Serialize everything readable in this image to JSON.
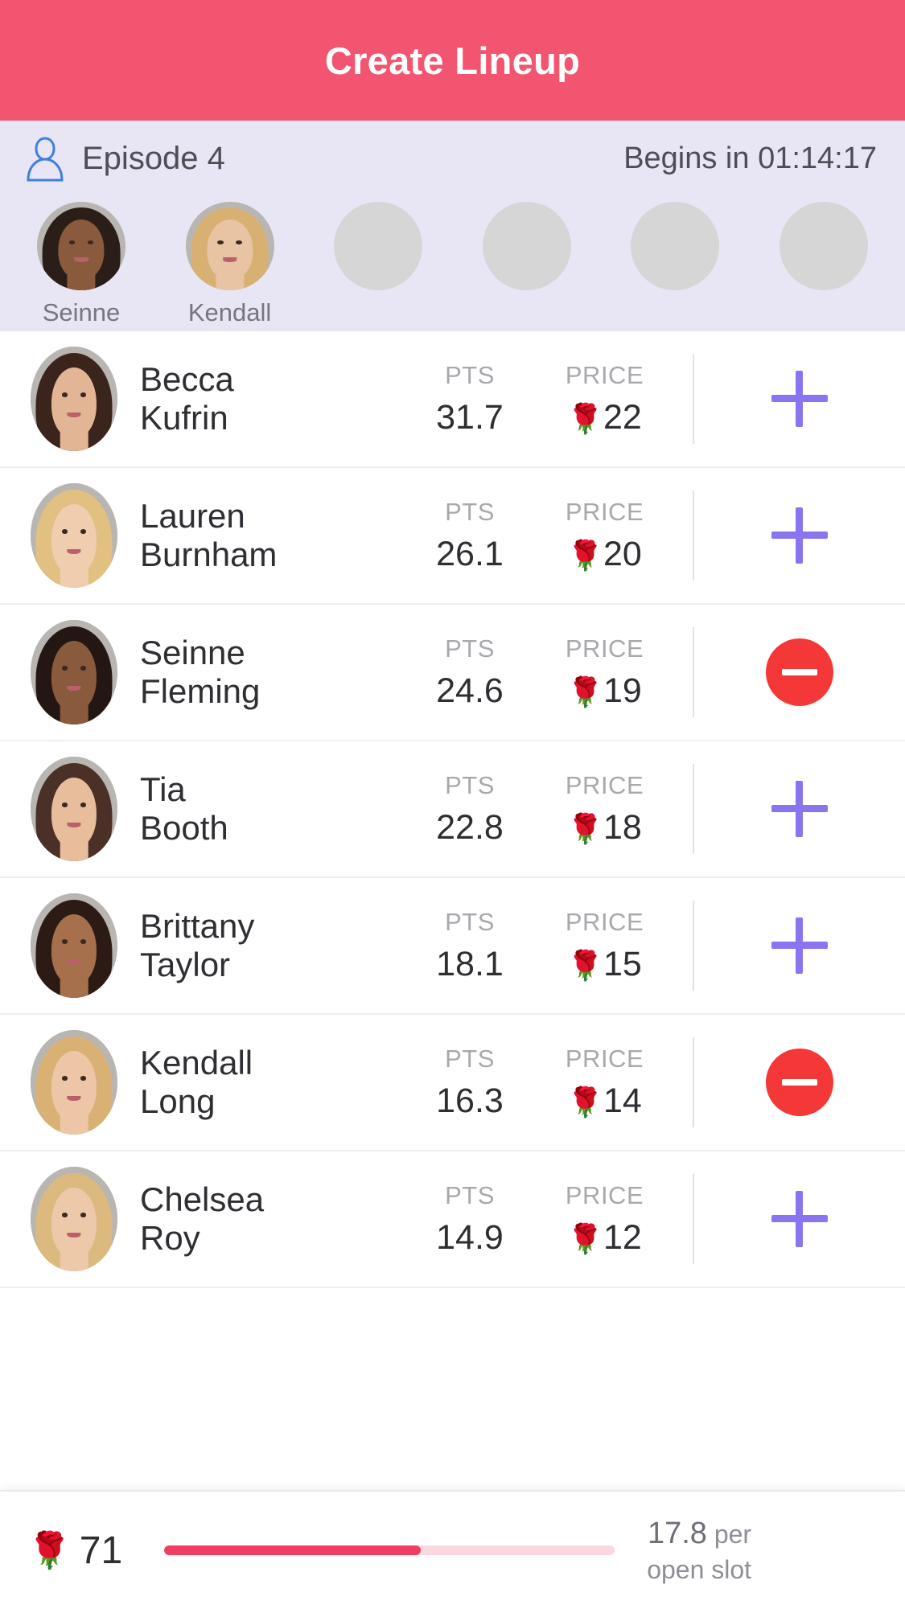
{
  "header": {
    "title": "Create Lineup",
    "bg_color": "#f2556f"
  },
  "episode_bar": {
    "icon": "person-bust-icon",
    "episode_label": "Episode 4",
    "countdown": "Begins in 01:14:17",
    "bg_color": "#e8e6f4",
    "slots": [
      {
        "name": "Seinne",
        "filled": true,
        "hair": "#2b1d18",
        "skin": "#8a5a3c"
      },
      {
        "name": "Kendall",
        "filled": true,
        "hair": "#d8b072",
        "skin": "#e8c3a4"
      },
      {
        "name": "",
        "filled": false,
        "hair": "",
        "skin": ""
      },
      {
        "name": "",
        "filled": false,
        "hair": "",
        "skin": ""
      },
      {
        "name": "",
        "filled": false,
        "hair": "",
        "skin": ""
      },
      {
        "name": "",
        "filled": false,
        "hair": "",
        "skin": ""
      }
    ]
  },
  "list": {
    "pts_label": "PTS",
    "price_label": "PRICE",
    "rose_glyph": "🌹",
    "plus_color": "#8b74f0",
    "minus_color": "#f43737",
    "players": [
      {
        "first": "Becca",
        "last": "Kufrin",
        "pts": "31.7",
        "price": "22",
        "action": "add",
        "hair": "#3a241c",
        "skin": "#e2b595"
      },
      {
        "first": "Lauren",
        "last": "Burnham",
        "pts": "26.1",
        "price": "20",
        "action": "add",
        "hair": "#e2c081",
        "skin": "#f0cdae"
      },
      {
        "first": "Seinne",
        "last": "Fleming",
        "pts": "24.6",
        "price": "19",
        "action": "remove",
        "hair": "#241713",
        "skin": "#8a5a3c"
      },
      {
        "first": "Tia",
        "last": "Booth",
        "pts": "22.8",
        "price": "18",
        "action": "add",
        "hair": "#4a3026",
        "skin": "#e8bd9c"
      },
      {
        "first": "Brittany",
        "last": "Taylor",
        "pts": "18.1",
        "price": "15",
        "action": "add",
        "hair": "#2c1b15",
        "skin": "#a6704c"
      },
      {
        "first": "Kendall",
        "last": "Long",
        "pts": "16.3",
        "price": "14",
        "action": "remove",
        "hair": "#d9b174",
        "skin": "#ecc6a6"
      },
      {
        "first": "Chelsea",
        "last": "Roy",
        "pts": "14.9",
        "price": "12",
        "action": "add",
        "hair": "#dcb97f",
        "skin": "#eec9a9"
      }
    ]
  },
  "bottom_bar": {
    "rose_glyph": "🌹",
    "budget_remaining": "71",
    "progress_percent": 57,
    "per_slot_amount": "17.8",
    "per_slot_unit": "per",
    "per_slot_suffix": "open slot",
    "track_color": "#fbd7df",
    "fill_color": "#f23d63"
  }
}
